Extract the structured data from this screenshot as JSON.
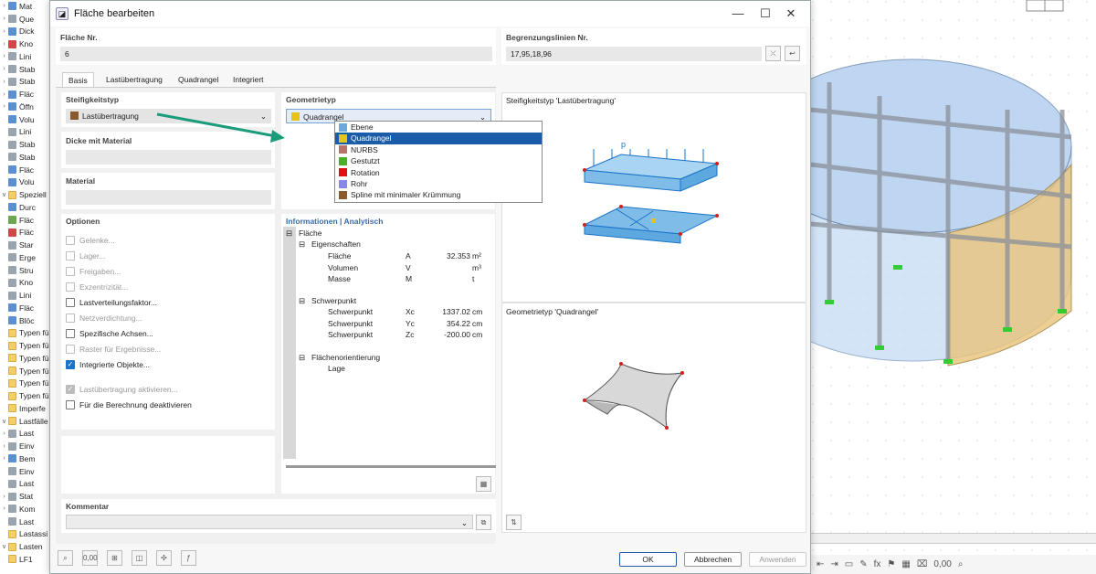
{
  "tree": [
    {
      "c": "›",
      "icon": "blue",
      "label": "Mat"
    },
    {
      "c": "›",
      "icon": "gray",
      "label": "Que"
    },
    {
      "c": "›",
      "icon": "blue",
      "label": "Dick"
    },
    {
      "c": "›",
      "icon": "red",
      "label": "Kno"
    },
    {
      "c": "›",
      "icon": "gray",
      "label": "Lini"
    },
    {
      "c": "›",
      "icon": "gray",
      "label": "Stab"
    },
    {
      "c": "›",
      "icon": "gray",
      "label": "Stab"
    },
    {
      "c": "›",
      "icon": "blue",
      "label": "Fläc"
    },
    {
      "c": "›",
      "icon": "blue",
      "label": "Öffn"
    },
    {
      "c": "",
      "icon": "blue",
      "label": "Volu"
    },
    {
      "c": "",
      "icon": "gray",
      "label": "Lini"
    },
    {
      "c": "",
      "icon": "gray",
      "label": "Stab"
    },
    {
      "c": "",
      "icon": "gray",
      "label": "Stab"
    },
    {
      "c": "",
      "icon": "blue",
      "label": "Fläc"
    },
    {
      "c": "",
      "icon": "blue",
      "label": "Volu"
    },
    {
      "c": "∨",
      "icon": "folder",
      "label": "Speziell"
    },
    {
      "c": "",
      "icon": "blue",
      "label": "Durc"
    },
    {
      "c": "",
      "icon": "green",
      "label": "Fläc"
    },
    {
      "c": "",
      "icon": "red",
      "label": "Fläc"
    },
    {
      "c": "",
      "icon": "gray",
      "label": "Star"
    },
    {
      "c": "",
      "icon": "gray",
      "label": "Erge"
    },
    {
      "c": "",
      "icon": "gray",
      "label": "Stru"
    },
    {
      "c": "",
      "icon": "gray",
      "label": "Kno"
    },
    {
      "c": "",
      "icon": "gray",
      "label": "Lini"
    },
    {
      "c": "",
      "icon": "blue",
      "label": "Fläc"
    },
    {
      "c": "",
      "icon": "blue",
      "label": "Blöc"
    },
    {
      "c": "",
      "icon": "folder",
      "label": "Typen fü"
    },
    {
      "c": "",
      "icon": "folder",
      "label": "Typen fü"
    },
    {
      "c": "",
      "icon": "folder",
      "label": "Typen fü"
    },
    {
      "c": "",
      "icon": "folder",
      "label": "Typen fü"
    },
    {
      "c": "",
      "icon": "folder",
      "label": "Typen fü"
    },
    {
      "c": "",
      "icon": "folder",
      "label": "Typen fü"
    },
    {
      "c": "",
      "icon": "folder",
      "label": "Imperfe"
    },
    {
      "c": "∨",
      "icon": "folder",
      "label": "Lastfälle"
    },
    {
      "c": "›",
      "icon": "gray",
      "label": "Last"
    },
    {
      "c": "›",
      "icon": "gray",
      "label": "Einv"
    },
    {
      "c": "›",
      "icon": "blue",
      "label": "Bem"
    },
    {
      "c": "",
      "icon": "gray",
      "label": "Einv"
    },
    {
      "c": "",
      "icon": "gray",
      "label": "Last"
    },
    {
      "c": "›",
      "icon": "gray",
      "label": "Stat"
    },
    {
      "c": "›",
      "icon": "gray",
      "label": "Kom"
    },
    {
      "c": "",
      "icon": "gray",
      "label": "Last"
    },
    {
      "c": "",
      "icon": "folder",
      "label": "Lastassi"
    },
    {
      "c": "∨",
      "icon": "folder",
      "label": "Lasten"
    },
    {
      "c": "",
      "icon": "folder",
      "label": "LF1"
    }
  ],
  "dialog": {
    "title": "Fläche bearbeiten",
    "flaeche_nr_label": "Fläche Nr.",
    "flaeche_nr": "6",
    "begrenz_label": "Begrenzungslinien Nr.",
    "begrenz": "17,95,18,96",
    "tabs": [
      "Basis",
      "Lastübertragung",
      "Quadrangel",
      "Integriert"
    ],
    "steif_label": "Steifigkeitstyp",
    "steif_value": "Lastübertragung",
    "steif_color": "#8a5a2b",
    "dicke_label": "Dicke mit Material",
    "material_label": "Material",
    "optionen_label": "Optionen",
    "options": [
      {
        "label": "Gelenke...",
        "state": "dis"
      },
      {
        "label": "Lager...",
        "state": "dis"
      },
      {
        "label": "Freigaben...",
        "state": "dis"
      },
      {
        "label": "Exzentrizität...",
        "state": "dis"
      },
      {
        "label": "Lastverteilungsfaktor...",
        "state": "off"
      },
      {
        "label": "Netzverdichtung...",
        "state": "dis"
      },
      {
        "label": "Spezifische Achsen...",
        "state": "off"
      },
      {
        "label": "Raster für Ergebnisse...",
        "state": "dis"
      },
      {
        "label": "Integrierte Objekte...",
        "state": "on"
      },
      {
        "label": "Lastübertragung aktivieren...",
        "state": "ondis"
      },
      {
        "label": "Für die Berechnung deaktivieren",
        "state": "off"
      }
    ],
    "geom_label": "Geometrietyp",
    "geom_value": "Quadrangel",
    "geom_options": [
      {
        "label": "Ebene",
        "color": "#6fa8dc"
      },
      {
        "label": "Quadrangel",
        "color": "#e6c21a"
      },
      {
        "label": "NURBS",
        "color": "#c0706a"
      },
      {
        "label": "Gestutzt",
        "color": "#4caf2a"
      },
      {
        "label": "Rotation",
        "color": "#e01010"
      },
      {
        "label": "Rohr",
        "color": "#8888e8"
      },
      {
        "label": "Spline mit minimaler Krümmung",
        "color": "#8a5a2b"
      }
    ],
    "info_label": "Informationen | Analytisch",
    "info": {
      "root": "Fläche",
      "g1": "Eigenschaften",
      "rows1": [
        {
          "n": "Fläche",
          "s": "A",
          "v": "32.353",
          "u": "m²"
        },
        {
          "n": "Volumen",
          "s": "V",
          "v": "",
          "u": "m³"
        },
        {
          "n": "Masse",
          "s": "M",
          "v": "",
          "u": "t"
        }
      ],
      "g2": "Schwerpunkt",
      "rows2": [
        {
          "n": "Schwerpunkt",
          "s": "Xc",
          "v": "1337.02",
          "u": "cm"
        },
        {
          "n": "Schwerpunkt",
          "s": "Yc",
          "v": "354.22",
          "u": "cm"
        },
        {
          "n": "Schwerpunkt",
          "s": "Zc",
          "v": "-200.00",
          "u": "cm"
        }
      ],
      "g3": "Flächenorientierung",
      "rows3": [
        {
          "n": "Lage",
          "s": "",
          "v": "",
          "u": ""
        }
      ]
    },
    "preview1_title": "Steifigkeitstyp 'Lastübertragung'",
    "preview1_p": "p",
    "preview2_title": "Geometrietyp 'Quadrangel'",
    "kommentar_label": "Kommentar",
    "buttons": {
      "ok": "OK",
      "abbrechen": "Abbrechen",
      "anwenden": "Anwenden"
    },
    "bottom_icons": [
      {
        "name": "search-icon",
        "g": "⌕"
      },
      {
        "name": "units-icon",
        "g": "0,00"
      },
      {
        "name": "model-icon",
        "g": "⊞"
      },
      {
        "name": "view-icon",
        "g": "◫"
      },
      {
        "name": "select-icon",
        "g": "✣"
      },
      {
        "name": "function-icon",
        "g": "ƒ"
      }
    ]
  },
  "view_toolbar": [
    "⇤",
    "⇥",
    "▭",
    "✎",
    "fx",
    "⚑",
    "▦",
    "⌧",
    "0,00",
    "⌕"
  ],
  "colors": {
    "accent": "#1a5ca8",
    "arrow": "#1a9c7a",
    "surface_blue": "#a9c9ee",
    "surface_orange": "#e9c47a"
  }
}
